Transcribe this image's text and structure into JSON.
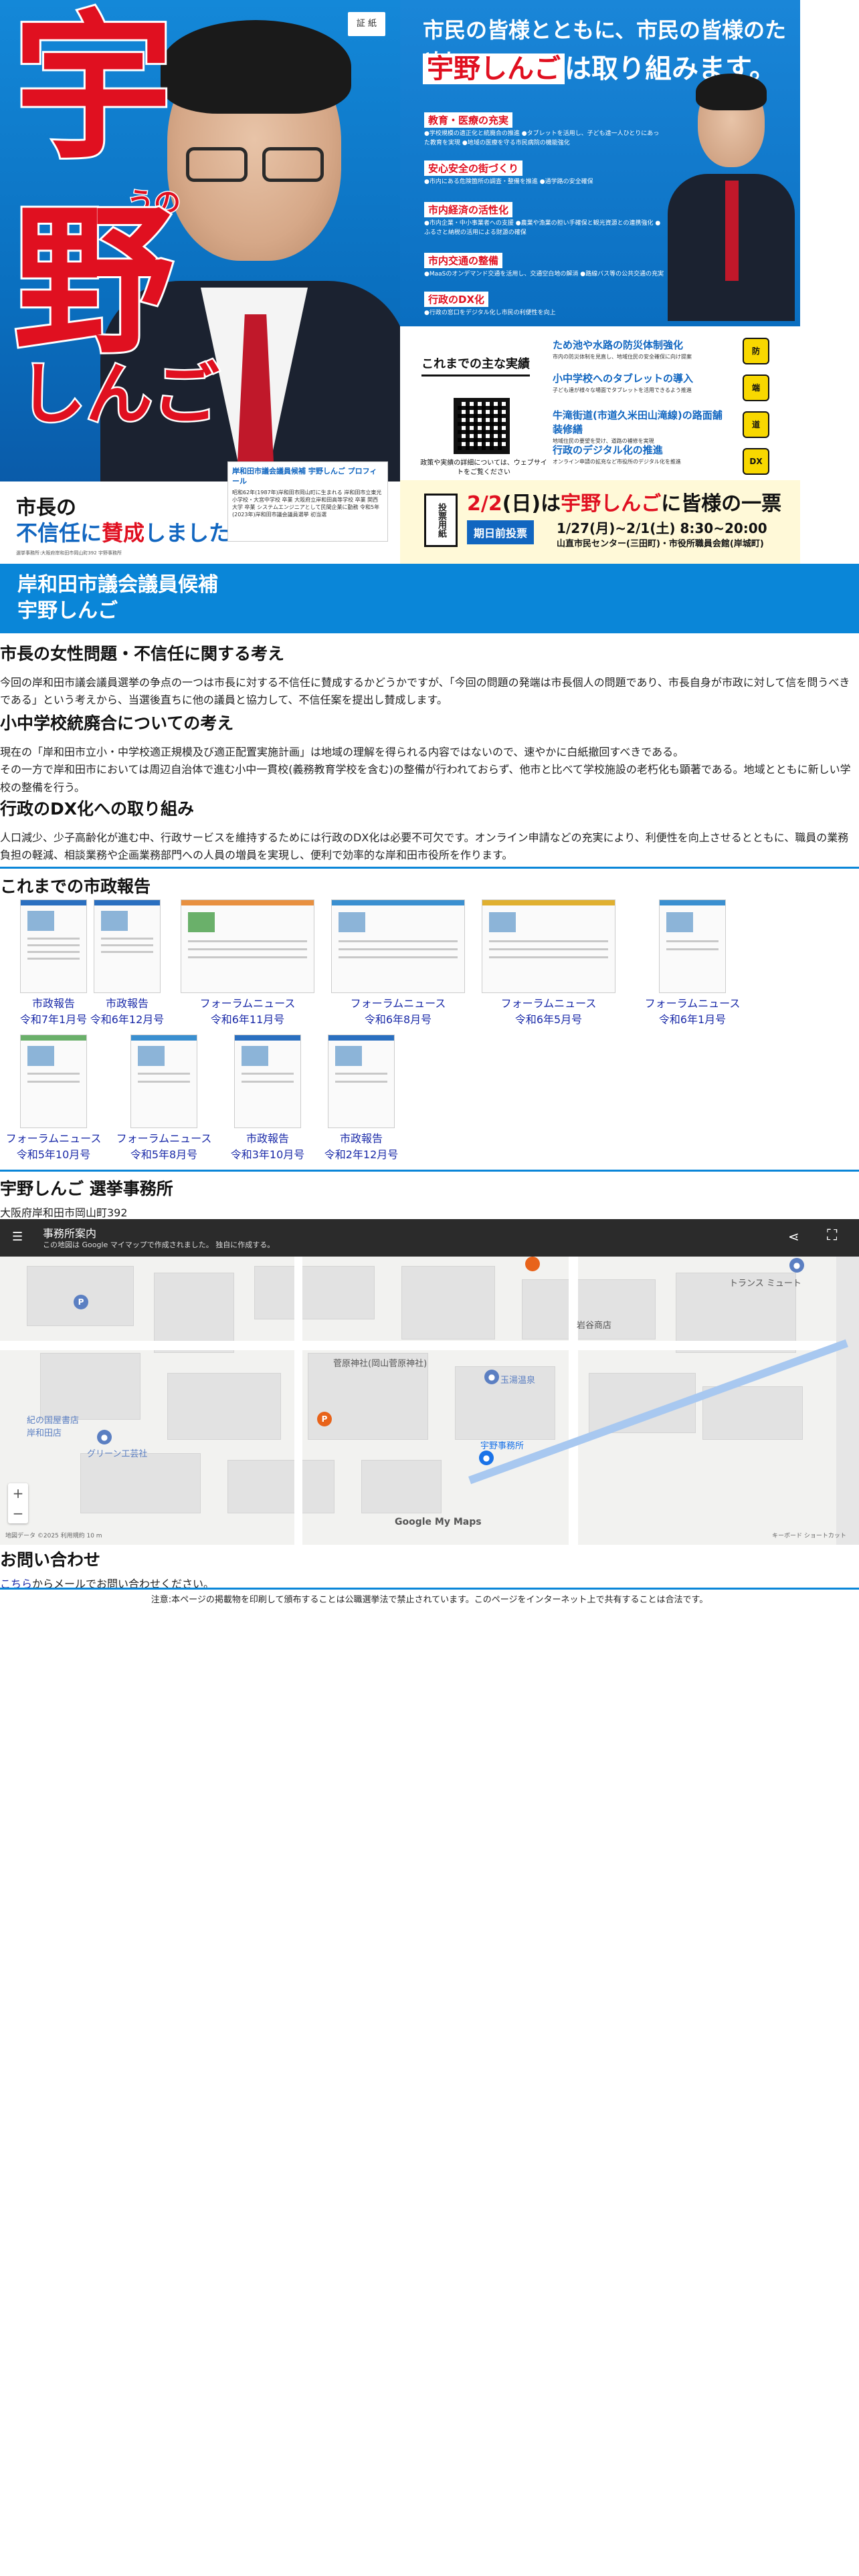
{
  "flyer": {
    "seal": "証 紙",
    "name_kanji_1": "宇",
    "name_kanji_2": "野",
    "name_ruby": "うの",
    "name_kana": "しんご",
    "no_confidence_line1": "市長の",
    "no_confidence_line2a": "不信任に",
    "no_confidence_line2b": "賛成",
    "no_confidence_line2c": "しました!",
    "profile_title": "岸和田市議会議員候補 宇野しんご プロフィール",
    "profile_text": "昭和62年(1987年)岸和田市岡山町に生まれる 岸和田市立東光小学校・大宮中学校 卒業 大阪府立岸和田高等学校 卒業 関西大学 卒業 システムエンジニアとして民間企業に勤務 令和5年(2023年)岸和田市議会議員選挙 初当選",
    "footnote": "選挙事務所:大阪府岸和田市岡山町392 宇野事務所",
    "right_heading1": "市民の皆様とともに、市民の皆様のために",
    "right_heading2a": "宇野しんご",
    "right_heading2b": "は取り組みます。",
    "policies": [
      {
        "title": "教育・医療の充実",
        "lines": "●学校規模の適正化と統廃合の推進 ●タブレットを活用し、子ども達一人ひとりにあった教育を実現 ●地域の医療を守る市民病院の機能強化"
      },
      {
        "title": "安心安全の街づくり",
        "lines": "●市内にある危険箇所の調査・整備を推進 ●通学路の安全確保"
      },
      {
        "title": "市内経済の活性化",
        "lines": "●市内企業・中小事業者への支援 ●農業や漁業の担い手確保と観光資源との連携強化 ●ふるさと納税の活用による財源の確保"
      },
      {
        "title": "市内交通の整備",
        "lines": "●MaaSのオンデマンド交通を活用し、交通空白地の解消 ●路線バス等の公共交通の充実"
      },
      {
        "title": "行政のDX化",
        "lines": "●行政の窓口をデジタル化し市民の利便性を向上"
      }
    ],
    "achievements_title": "これまでの主な実績",
    "qr_note": "政策や実績の詳細については、ウェブサイトをご覧ください",
    "achievements": [
      {
        "title": "ため池や水路の防災体制強化",
        "desc": "市内の防災体制を見直し、地域住民の安全確保に向け提案",
        "icon": "防"
      },
      {
        "title": "小中学校へのタブレットの導入",
        "desc": "子ども達が様々な場面でタブレットを活用できるよう推進",
        "icon": "端"
      },
      {
        "title": "牛滝街道(市道久米田山滝線)の路面舗装修繕",
        "desc": "地域住民の要望を受け、道路の補修を実現",
        "icon": "道"
      },
      {
        "title": "行政のデジタル化の推進",
        "desc": "オンライン申請の拡充など市役所のデジタル化を推進",
        "icon": "DX"
      }
    ],
    "ballot": "投票用紙",
    "vote_a": "2/2",
    "vote_b": "(日)は",
    "vote_c": "宇野しんご",
    "vote_d": "に皆様の一票を!",
    "early_tag": "期日前投票",
    "early_date": "1/27(月)~2/1(土) 8:30~20:00",
    "early_place": "山直市民センター(三田町)・市役所職員会館(岸城町)"
  },
  "banner": {
    "line1": "岸和田市議会議員候補",
    "line2": "宇野しんご"
  },
  "articles": [
    {
      "title": "市長の女性問題・不信任に関する考え",
      "body": "今回の岸和田市議会議員選挙の争点の一つは市長に対する不信任に賛成するかどうかですが、「今回の問題の発端は市長個人の問題であり、市長自身が市政に対して信を問うべきである」という考えから、当選後直ちに他の議員と協力して、不信任案を提出し賛成します。"
    },
    {
      "title": "小中学校統廃合についての考え",
      "body": "現在の「岸和田市立小・中学校適正規模及び適正配置実施計画」は地域の理解を得られる内容ではないので、速やかに白紙撤回すべきである。\nその一方で岸和田市においては周辺自治体で進む小中一貫校(義務教育学校を含む)の整備が行われておらず、他市と比べて学校施設の老朽化も顕著である。地域とともに新しい学校の整備を行う。"
    },
    {
      "title": "行政のDX化への取り組み",
      "body": "人口減少、少子高齢化が進む中、行政サービスを維持するためには行政のDX化は必要不可欠です。オンライン申請などの充実により、利便性を向上させるとともに、職員の業務負担の軽減、相談業務や企画業務部門への人員の増員を実現し、便利で効率的な岸和田市役所を作ります。"
    }
  ],
  "reports": {
    "title": "これまでの市政報告",
    "items": [
      {
        "type": "市政報告",
        "date": "令和7年1月号"
      },
      {
        "type": "市政報告",
        "date": "令和6年12月号"
      },
      {
        "type": "フォーラムニュース",
        "date": "令和6年11月号"
      },
      {
        "type": "フォーラムニュース",
        "date": "令和6年8月号"
      },
      {
        "type": "フォーラムニュース",
        "date": "令和6年5月号"
      },
      {
        "type": "フォーラムニュース",
        "date": "令和6年1月号"
      },
      {
        "type": "フォーラムニュース",
        "date": "令和5年10月号"
      },
      {
        "type": "フォーラムニュース",
        "date": "令和5年8月号"
      },
      {
        "type": "市政報告",
        "date": "令和3年10月号"
      },
      {
        "type": "市政報告",
        "date": "令和2年12月号"
      }
    ]
  },
  "office": {
    "title": "宇野しんご 選挙事務所",
    "address": "大阪府岸和田市岡山町392"
  },
  "map": {
    "title": "事務所案内",
    "subtitle": "この地図は Google マイマップで作成されました。 独自に作成する。",
    "labels": {
      "sugawara": "菅原神社(岡山菅原神社)",
      "office": "宇野事務所",
      "green": "グリーン工芸社",
      "tamayu": "玉湯温泉",
      "trans": "トランス ミュート",
      "shop": "岩谷商店",
      "bookstore": "紀の国屋書店 岸和田店"
    },
    "google_logo": "Google My Maps",
    "footer_left": "地図データ ©2025 利用規約 10 m",
    "footer_right": "キーボード ショートカット",
    "colors": {
      "office_pin": "#1a73e8",
      "parking_pin": "#e8631a",
      "place_pin": "#5b7fc2"
    }
  },
  "contact": {
    "title": "お問い合わせ",
    "link": "こちら",
    "text": "からメールでお問い合わせください。"
  },
  "notice": "注意:本ページの掲載物を印刷して頒布することは公職選挙法で禁止されています。このページをインターネット上で共有することは合法です。",
  "colors": {
    "accent_blue": "#0a86d8",
    "candidate_red": "#e01020",
    "link": "#1a2aa8"
  }
}
